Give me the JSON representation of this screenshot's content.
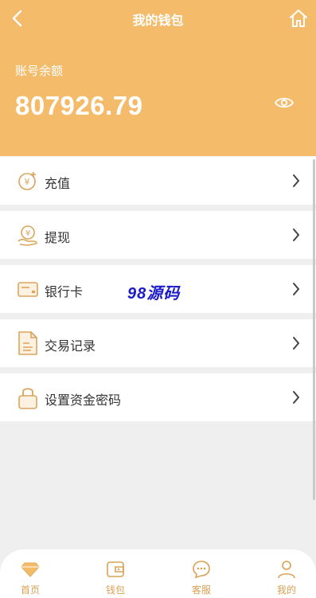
{
  "header": {
    "title": "我的钱包",
    "balance_label": "账号余额",
    "balance_value": "807926.79",
    "color": "#f4bb6b"
  },
  "menu": [
    {
      "label": "充值",
      "icon": "yuan-coin-icon"
    },
    {
      "label": "提现",
      "icon": "hand-coin-icon"
    },
    {
      "label": "银行卡",
      "icon": "bank-card-icon"
    },
    {
      "label": "交易记录",
      "icon": "document-icon"
    },
    {
      "label": "设置资金密码",
      "icon": "lock-icon"
    }
  ],
  "watermark": "98源码",
  "tabbar": [
    {
      "label": "首页",
      "icon": "diamond-icon",
      "active": true
    },
    {
      "label": "钱包",
      "icon": "wallet-icon"
    },
    {
      "label": "客服",
      "icon": "chat-icon"
    },
    {
      "label": "我的",
      "icon": "user-icon"
    }
  ],
  "accent_color": "#d8a256"
}
